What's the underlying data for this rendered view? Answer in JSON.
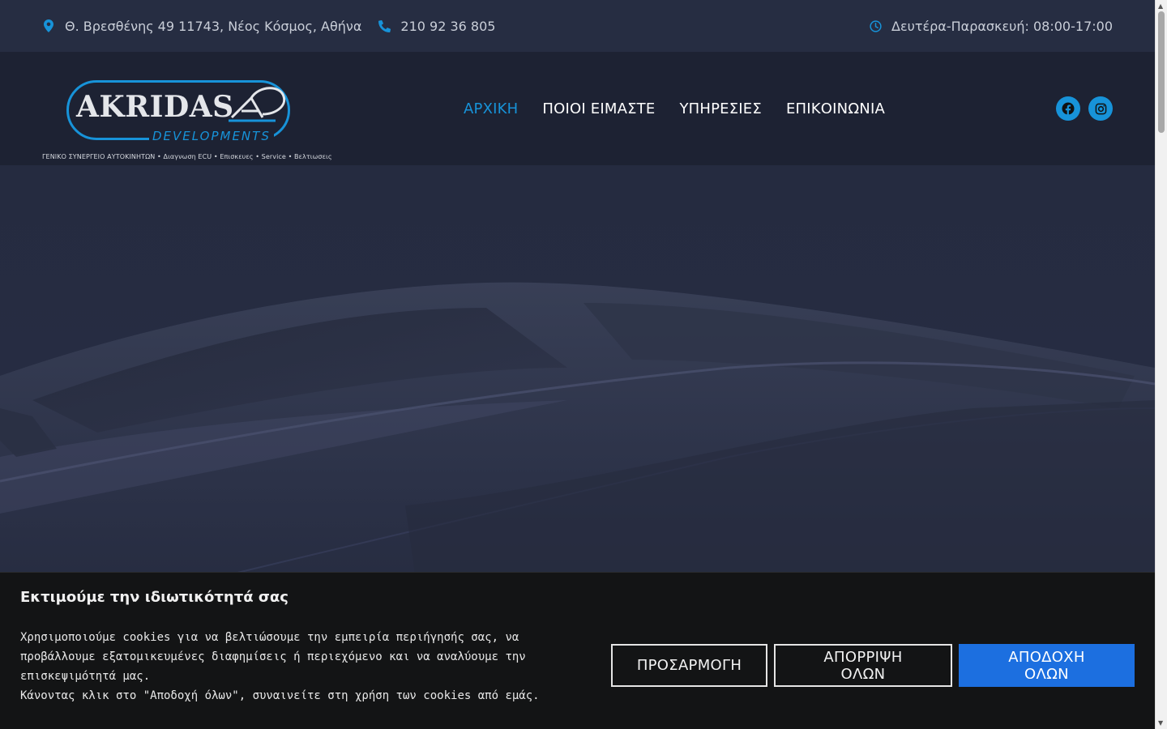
{
  "topbar": {
    "address": "Θ. Βρεσθένης 49 11743, Νέος Κόσμος, Αθήνα",
    "phone": "210 92 36 805",
    "hours": "Δευτέρα-Παρασκευή: 08:00-17:00",
    "icons": {
      "address": "map-pin-icon",
      "phone": "phone-icon",
      "hours": "clock-icon"
    }
  },
  "logo": {
    "main": "AKRIDAS",
    "sub": "DEVELOPMENTS",
    "tagline": "ΓΕΝΙΚΟ ΣΥΝΕΡΓΕΙΟ ΑΥΤΟΚΙΝΗΤΩΝ • Διαγνωση ECU • Επισκευες • Service • Βελτιωσεις"
  },
  "nav": {
    "items": [
      {
        "label": "ΑΡΧΙΚΗ",
        "active": true
      },
      {
        "label": "ΠΟΙΟΙ ΕΙΜΑΣΤΕ",
        "active": false
      },
      {
        "label": "ΥΠΗΡΕΣΙΕΣ",
        "active": false
      },
      {
        "label": "ΕΠΙΚΟΙΝΩΝΙΑ",
        "active": false
      }
    ]
  },
  "social": {
    "icons": [
      "facebook-icon",
      "instagram-icon"
    ]
  },
  "cookie": {
    "title": "Εκτιμούμε την ιδιωτικότητά σας",
    "text1": "Χρησιμοποιούμε cookies για να βελτιώσουμε την εμπειρία περιήγησής σας, να προβάλλουμε εξατομικευμένες διαφημίσεις ή περιεχόμενο και να αναλύουμε την επισκεψιμότητά μας.",
    "text2": "Κάνοντας κλικ στο \"Αποδοχή όλων\", συναινείτε στη χρήση των cookies από εμάς.",
    "customize_label": "ΠΡΟΣΑΡΜΟΓΗ",
    "reject_label": "ΑΠΟΡΡΙΨΗ ΟΛΩΝ",
    "accept_label": "ΑΠΟΔΟΧΗ ΟΛΩΝ"
  },
  "colors": {
    "accent": "#1793d9",
    "topbar_bg": "#262d42",
    "header_bg": "#1d2233",
    "cookie_bg": "#131415",
    "accept_button": "#1c6fe0"
  }
}
